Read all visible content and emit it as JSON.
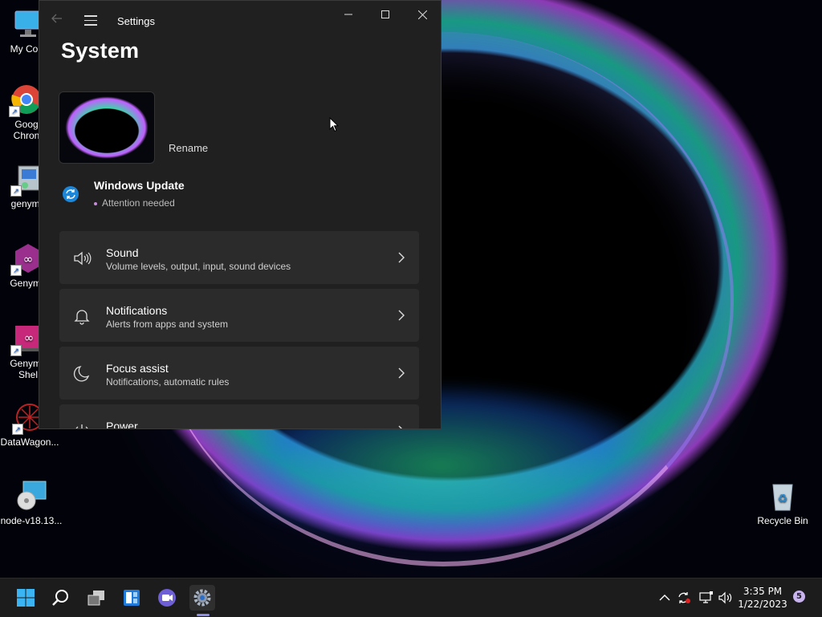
{
  "desktop": {
    "icons": [
      {
        "label": "My Com"
      },
      {
        "label": "Goog\nChron"
      },
      {
        "label": "genymo"
      },
      {
        "label": "Genymo"
      },
      {
        "label": "Genymo\nShel"
      },
      {
        "label": "DataWagon..."
      },
      {
        "label": "node-v18.13..."
      },
      {
        "label": "Recycle Bin"
      }
    ]
  },
  "settings": {
    "window_title": "Settings",
    "page_title": "System",
    "rename_label": "Rename",
    "windows_update": {
      "title": "Windows Update",
      "status": "Attention needed"
    },
    "cards": [
      {
        "title": "Sound",
        "desc": "Volume levels, output, input, sound devices",
        "icon": "speaker-icon"
      },
      {
        "title": "Notifications",
        "desc": "Alerts from apps and system",
        "icon": "bell-icon"
      },
      {
        "title": "Focus assist",
        "desc": "Notifications, automatic rules",
        "icon": "moon-icon"
      },
      {
        "title": "Power",
        "desc": "",
        "icon": "power-icon"
      }
    ]
  },
  "taskbar": {
    "time": "3:35 PM",
    "date": "1/22/2023",
    "notification_count": "5"
  },
  "colors": {
    "window_bg": "#202020",
    "card_bg": "#2b2b2b",
    "taskbar_bg": "#1c1c1c",
    "accent": "#8e8ee6"
  }
}
